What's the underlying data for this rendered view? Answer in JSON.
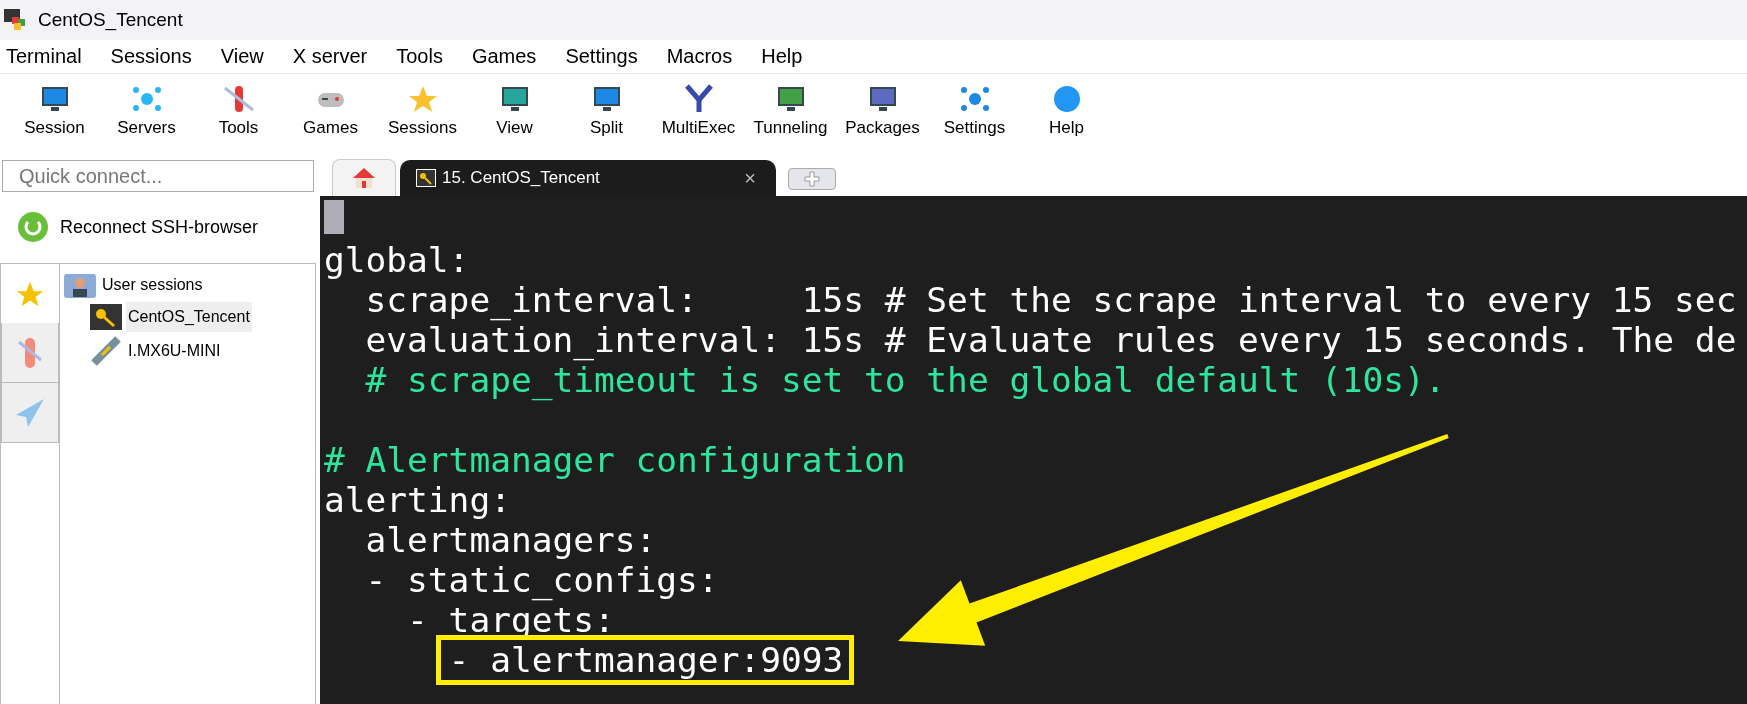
{
  "window": {
    "title": "CentOS_Tencent"
  },
  "menu": [
    "Terminal",
    "Sessions",
    "View",
    "X server",
    "Tools",
    "Games",
    "Settings",
    "Macros",
    "Help"
  ],
  "toolbar": [
    "Session",
    "Servers",
    "Tools",
    "Games",
    "Sessions",
    "View",
    "Split",
    "MultiExec",
    "Tunneling",
    "Packages",
    "Settings",
    "Help"
  ],
  "quick_connect": {
    "placeholder": "Quick connect..."
  },
  "reconnect_button": "Reconnect SSH-browser",
  "side_tabs": [
    {
      "selected": true
    },
    {
      "selected": false
    },
    {
      "selected": false
    }
  ],
  "sessions_tree": [
    {
      "label": "User sessions",
      "kind": "folder",
      "children": [
        {
          "label": "CentOS_Tencent",
          "kind": "ssh",
          "selected": true
        },
        {
          "label": "I.MX6U-MINI",
          "kind": "serial",
          "selected": false
        }
      ]
    }
  ],
  "tabs": [
    {
      "kind": "home",
      "selected": false
    },
    {
      "kind": "session",
      "label": "15. CentOS_Tencent",
      "close": "×",
      "selected": true
    },
    {
      "kind": "new",
      "selected": false
    }
  ],
  "terminal_lines": [
    {
      "kind": "plain",
      "text": "global:"
    },
    {
      "kind": "plain",
      "text": "  scrape_interval:     15s # Set the scrape interval to every 15 sec"
    },
    {
      "kind": "plain",
      "text": "  evaluation_interval: 15s # Evaluate rules every 15 seconds. The de"
    },
    {
      "kind": "comment",
      "text": "  # scrape_timeout is set to the global default (10s)."
    },
    {
      "kind": "blank"
    },
    {
      "kind": "comment",
      "text": "# Alertmanager configuration"
    },
    {
      "kind": "plain",
      "text": "alerting:"
    },
    {
      "kind": "plain",
      "text": "  alertmanagers:"
    },
    {
      "kind": "plain",
      "text": "  - static_configs:"
    },
    {
      "kind": "plain",
      "text": "    - targets:"
    },
    {
      "kind": "highlight",
      "text": "- alertmanager:9093"
    }
  ]
}
